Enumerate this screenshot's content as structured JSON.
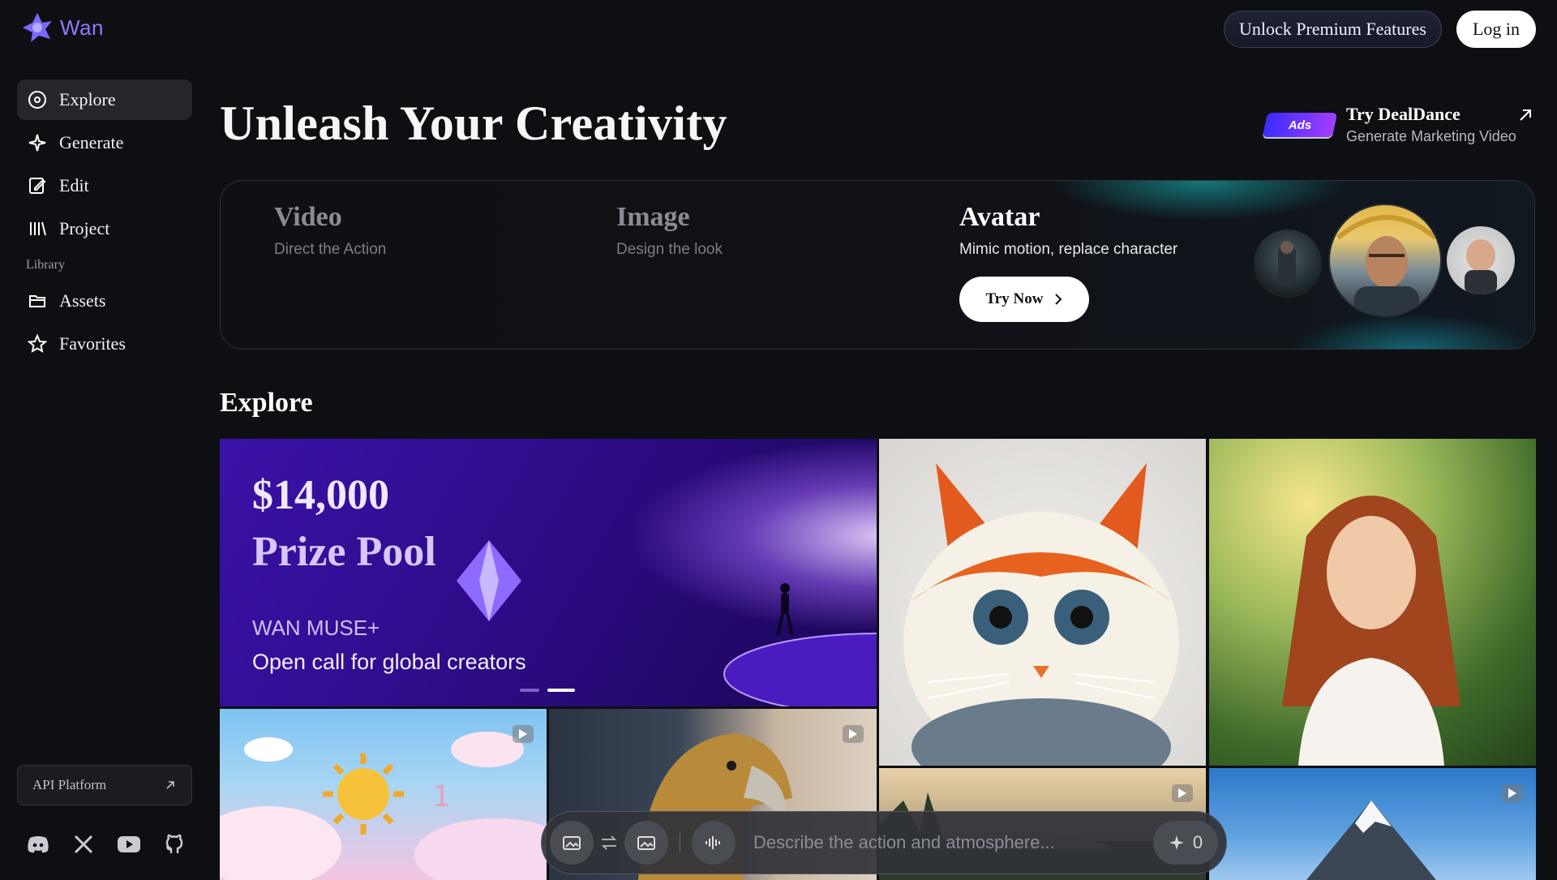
{
  "app": {
    "name": "Wan"
  },
  "header": {
    "premium_label": "Unlock Premium Features",
    "login_label": "Log in"
  },
  "sidebar": {
    "items": [
      {
        "label": "Explore",
        "icon": "compass-icon",
        "active": true
      },
      {
        "label": "Generate",
        "icon": "sparkle-icon",
        "active": false
      },
      {
        "label": "Edit",
        "icon": "edit-icon",
        "active": false
      },
      {
        "label": "Project",
        "icon": "library-icon",
        "active": false
      }
    ],
    "section_label": "Library",
    "library_items": [
      {
        "label": "Assets",
        "icon": "folder-icon"
      },
      {
        "label": "Favorites",
        "icon": "star-icon"
      }
    ],
    "api_label": "API Platform",
    "socials": [
      "discord-icon",
      "x-icon",
      "youtube-icon",
      "github-icon"
    ]
  },
  "hero": {
    "title": "Unleash Your Creativity"
  },
  "ad": {
    "badge": "Ads",
    "title": "Try DealDance",
    "subtitle": "Generate Marketing Video"
  },
  "modes": [
    {
      "title": "Video",
      "subtitle": "Direct the Action",
      "active": false
    },
    {
      "title": "Image",
      "subtitle": "Design the look",
      "active": false
    },
    {
      "title": "Avatar",
      "subtitle": "Mimic motion, replace character",
      "active": true
    }
  ],
  "try_now_label": "Try Now",
  "explore": {
    "title": "Explore"
  },
  "banner": {
    "amount": "$14,000",
    "pool": "Prize Pool",
    "brand": "WAN MUSE+",
    "tagline": "Open call for global creators"
  },
  "prompt": {
    "placeholder": "Describe the action and atmosphere...",
    "credits": "0"
  },
  "colors": {
    "accent": "#8e7bff",
    "background": "#0e0f13",
    "banner": "#3a12a8"
  }
}
